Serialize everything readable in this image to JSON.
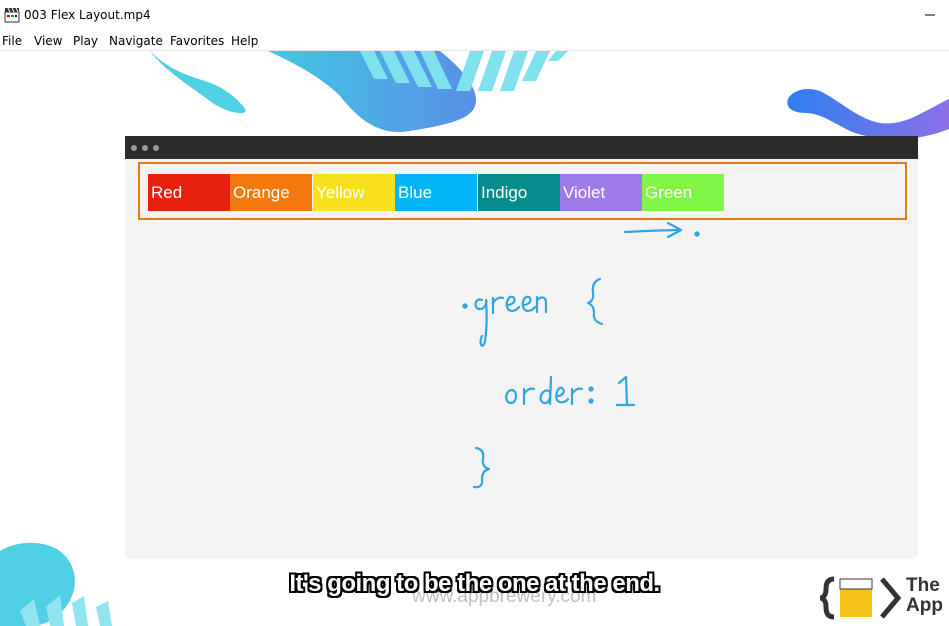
{
  "window": {
    "title": "003 Flex Layout.mp4",
    "minimize_icon": "minimize-icon",
    "app_icon": "clapperboard-icon"
  },
  "menu": {
    "items": [
      {
        "label": "File"
      },
      {
        "label": "View"
      },
      {
        "label": "Play"
      },
      {
        "label": "Navigate"
      },
      {
        "label": "Favorites"
      },
      {
        "label": "Help"
      }
    ]
  },
  "video": {
    "flex_items": [
      {
        "label": "Red",
        "color": "#e8210f"
      },
      {
        "label": "Orange",
        "color": "#f47a10"
      },
      {
        "label": "Yellow",
        "color": "#f6e11c"
      },
      {
        "label": "Blue",
        "color": "#04b5f5"
      },
      {
        "label": "Indigo",
        "color": "#068b8c"
      },
      {
        "label": "Violet",
        "color": "#9e79e8"
      },
      {
        "label": "Green",
        "color": "#80f546"
      }
    ],
    "container_border_color": "#e07a1f",
    "handwriting": {
      "line1": ".green {",
      "line2": "order : 1",
      "line3": "}"
    },
    "subtitle": "It's going to be the one at the end.",
    "watermark": "www.appbrewery.com",
    "logo": {
      "line1": "The",
      "line2": "App Brewery"
    }
  }
}
